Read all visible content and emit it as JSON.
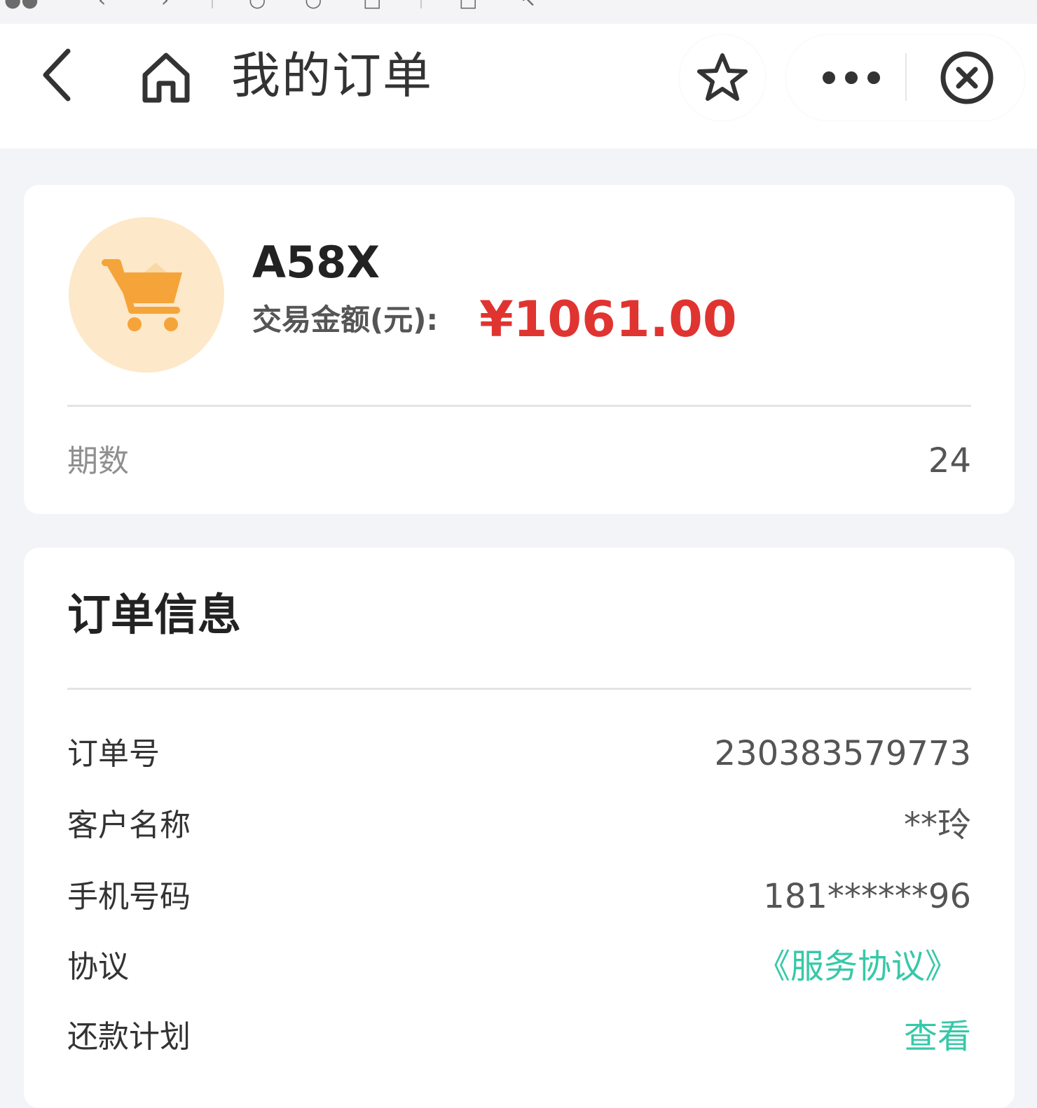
{
  "header": {
    "title": "我的订单"
  },
  "product": {
    "name": "A58X",
    "amount_label": "交易金额(元):",
    "amount_value": "¥1061.00",
    "periods_label": "期数",
    "periods_value": "24"
  },
  "order_info": {
    "title": "订单信息",
    "rows": [
      {
        "label": "订单号",
        "value": "230383579773"
      },
      {
        "label": "客户名称",
        "value": "**玲"
      },
      {
        "label": "手机号码",
        "value": "181******96"
      },
      {
        "label": "协议",
        "value": "《服务协议》"
      },
      {
        "label": "还款计划",
        "value": "查看"
      }
    ]
  },
  "colors": {
    "amount": "#e03431",
    "link": "#37c8a8",
    "cart": "#f5a43a",
    "cart_bg": "#fde8c9"
  },
  "icons": {
    "back": "chevron-left-icon",
    "home": "home-icon",
    "favorite": "star-icon",
    "more": "more-dots-icon",
    "close": "close-circle-icon",
    "cart": "shopping-cart-icon"
  }
}
